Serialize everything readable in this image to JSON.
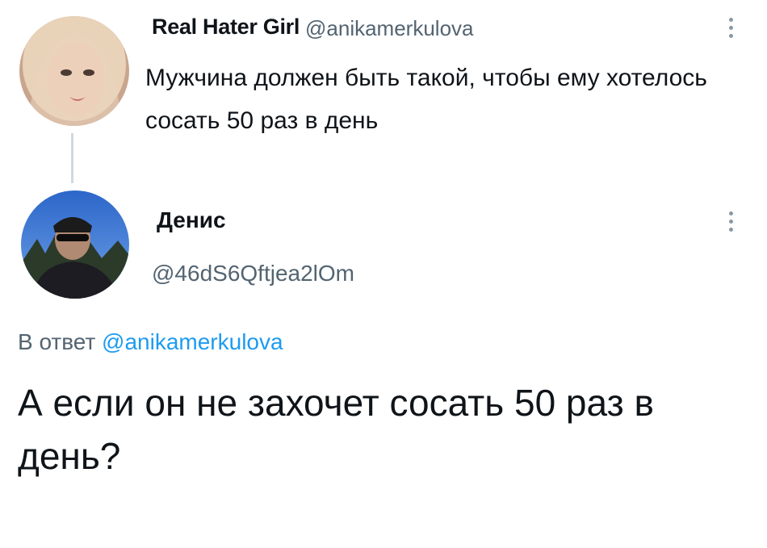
{
  "original_tweet": {
    "author_name": "Real Hater Girl",
    "author_handle": "@anikamerkulova",
    "text": "Мужчина должен быть такой, чтобы ему хотелось сосать 50 раз в день",
    "avatar_icon": "user-avatar-blonde-woman"
  },
  "reply_tweet": {
    "author_name": "Денис",
    "author_handle": "@46dS6Qftjea2lOm",
    "avatar_icon": "user-avatar-man-sunglasses",
    "reply_prefix": "В ответ",
    "reply_to_handle": "@anikamerkulova",
    "text": "А если он не захочет сосать 50 раз в день?"
  },
  "colors": {
    "text_primary": "#0f1419",
    "text_secondary": "#536471",
    "link": "#1d9bf0",
    "thread_line": "#cfd9de"
  },
  "icons": [
    "more-options-icon"
  ]
}
